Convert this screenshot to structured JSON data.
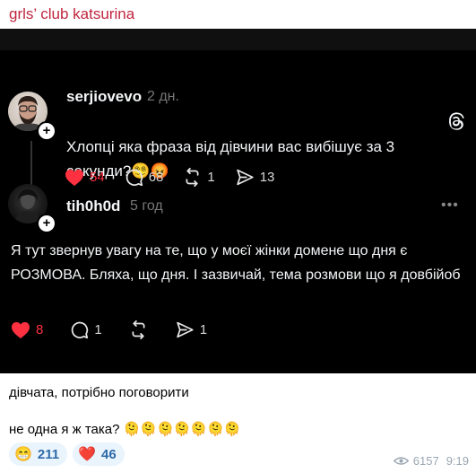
{
  "channel": {
    "name": "grls’ club katsurina"
  },
  "thread": {
    "post1": {
      "username": "serjiovevo",
      "time": "2 дн.",
      "text": "Хлопці яка фраза від дівчини  вас вибішує за 3 секунди?😵‍💫😡",
      "likes": "54",
      "replies": "68",
      "reposts": "1",
      "shares": "13"
    },
    "post2": {
      "username": "tih0h0d",
      "time": "5 год",
      "text": "Я тут звернув увагу на те, що у моєї жінки домене що дня є РОЗМОВА. Бляха, що дня. І зазвичай, тема розмови що я довбійоб",
      "likes": "8",
      "replies": "1",
      "shares": "1"
    }
  },
  "message": {
    "caption1": "дівчата, потрібно поговорити",
    "caption2": "не одна я ж така? 🫠🫠🫠🫠🫠🫠🫠",
    "reactions": [
      {
        "emoji": "😁",
        "count": "211"
      },
      {
        "emoji": "❤️",
        "count": "46"
      }
    ],
    "views": "6157",
    "time": "9:19"
  },
  "colors": {
    "channel_accent": "#c0263f",
    "like_red": "#ff3040",
    "background_dark": "#000000"
  }
}
